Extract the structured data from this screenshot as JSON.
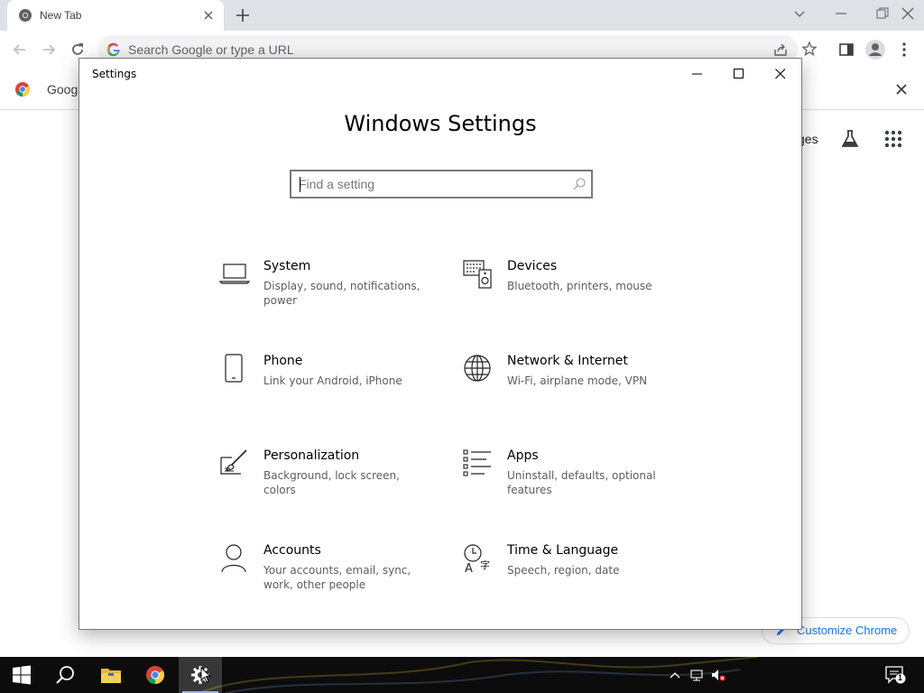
{
  "browser": {
    "tab_title": "New Tab",
    "omnibox_placeholder": "Search Google or type a URL",
    "infobar_text": "Googl",
    "ntp_images_link": "ges",
    "customize_label": "Customize Chrome"
  },
  "settings": {
    "window_title": "Settings",
    "heading": "Windows Settings",
    "search_placeholder": "Find a setting",
    "categories": [
      {
        "name": "System",
        "desc": "Display, sound, notifications, power",
        "icon": "laptop-icon"
      },
      {
        "name": "Devices",
        "desc": "Bluetooth, printers, mouse",
        "icon": "devices-icon"
      },
      {
        "name": "Phone",
        "desc": "Link your Android, iPhone",
        "icon": "phone-icon"
      },
      {
        "name": "Network & Internet",
        "desc": "Wi-Fi, airplane mode, VPN",
        "icon": "globe-icon"
      },
      {
        "name": "Personalization",
        "desc": "Background, lock screen, colors",
        "icon": "paintbrush-icon"
      },
      {
        "name": "Apps",
        "desc": "Uninstall, defaults, optional features",
        "icon": "apps-list-icon"
      },
      {
        "name": "Accounts",
        "desc": "Your accounts, email, sync, work, other people",
        "icon": "person-icon"
      },
      {
        "name": "Time & Language",
        "desc": "Speech, region, date",
        "icon": "time-language-icon"
      }
    ]
  },
  "taskbar": {
    "clock_time": "",
    "clock_date": "",
    "notification_count": "1"
  },
  "colors": {
    "chrome_tabstrip": "#dee1e6",
    "taskbar": "#0c0c0c",
    "accent_blue": "#1a73e8"
  }
}
